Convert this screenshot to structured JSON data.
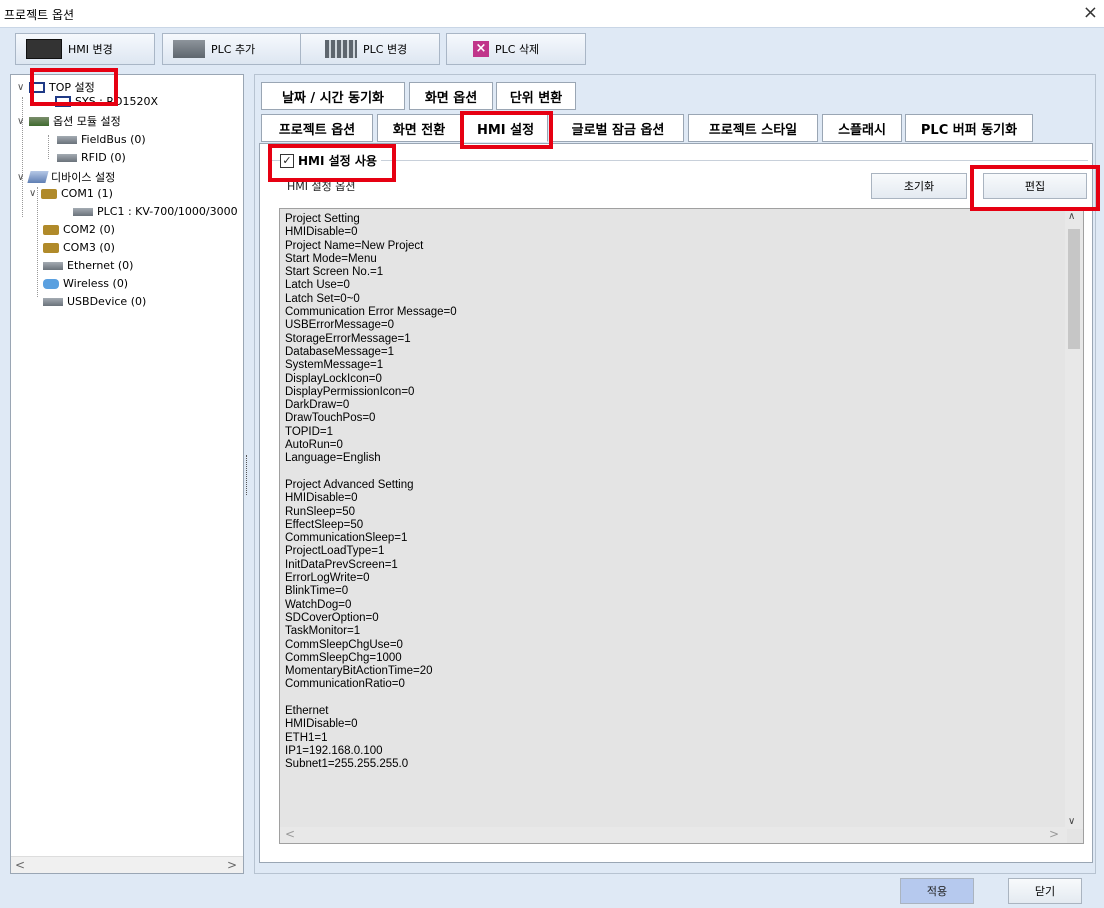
{
  "window": {
    "title": "프로젝트 옵션",
    "close_glyph": "×"
  },
  "toolbar": {
    "hmi_change": "HMI 변경",
    "plc_add": "PLC 추가",
    "plc_change": "PLC 변경",
    "plc_delete": "PLC 삭제"
  },
  "tree": {
    "top_settings": "TOP 설정",
    "sys": "SYS : RD1520X",
    "option_module": "옵션 모듈 설정",
    "fieldbus": "FieldBus (0)",
    "rfid": "RFID (0)",
    "device_settings": "디바이스 설정",
    "com1": "COM1 (1)",
    "plc1": "PLC1 : KV-700/1000/3000",
    "com2": "COM2 (0)",
    "com3": "COM3 (0)",
    "ethernet": "Ethernet (0)",
    "wireless": "Wireless (0)",
    "usbdevice": "USBDevice (0)"
  },
  "tabs_row1": [
    "날짜 / 시간 동기화",
    "화면 옵션",
    "단위 변환"
  ],
  "tabs_row2": [
    "프로젝트 옵션",
    "화면 전환",
    "HMI 설정",
    "글로벌 잠금 옵션",
    "프로젝트 스타일",
    "스플래시",
    "PLC 버퍼 동기화"
  ],
  "active_tab": "HMI 설정",
  "hmi": {
    "use_label": "HMI 설정 사용",
    "checked": true,
    "check_glyph": "✓",
    "options_label": "HMI 설정 옵션",
    "reset_button": "초기화",
    "edit_button": "편집"
  },
  "settings_text": [
    "Project Setting",
    "HMIDisable=0",
    "Project Name=New Project",
    "Start Mode=Menu",
    "Start Screen No.=1",
    "Latch Use=0",
    "Latch Set=0~0",
    "Communication Error Message=0",
    "USBErrorMessage=0",
    "StorageErrorMessage=1",
    "DatabaseMessage=1",
    "SystemMessage=1",
    "DisplayLockIcon=0",
    "DisplayPermissionIcon=0",
    "DarkDraw=0",
    "DrawTouchPos=0",
    "TOPID=1",
    "AutoRun=0",
    "Language=English",
    "",
    "Project Advanced Setting",
    "HMIDisable=0",
    "RunSleep=50",
    "EffectSleep=50",
    "CommunicationSleep=1",
    "ProjectLoadType=1",
    "InitDataPrevScreen=1",
    "ErrorLogWrite=0",
    "BlinkTime=0",
    "WatchDog=0",
    "SDCoverOption=0",
    "TaskMonitor=1",
    "CommSleepChgUse=0",
    "CommSleepChg=1000",
    "MomentaryBitActionTime=20",
    "CommunicationRatio=0",
    "",
    "Ethernet",
    "HMIDisable=0",
    "ETH1=1",
    "IP1=192.168.0.100",
    "Subnet1=255.255.255.0"
  ],
  "footer": {
    "apply": "적용",
    "close": "닫기"
  },
  "colors": {
    "highlight": "#e60012",
    "background": "#dfe9f5",
    "apply_button": "#b6c9ee"
  }
}
